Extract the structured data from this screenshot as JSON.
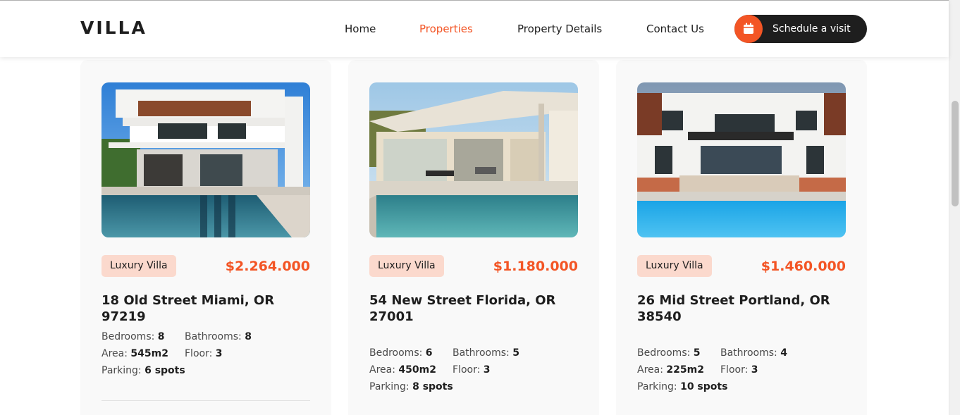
{
  "brand": {
    "logo": "VILLA"
  },
  "nav": {
    "items": [
      {
        "label": "Home",
        "active": false
      },
      {
        "label": "Properties",
        "active": true
      },
      {
        "label": "Property Details",
        "active": false
      },
      {
        "label": "Contact Us",
        "active": false
      }
    ],
    "cta": {
      "label": "Schedule a visit",
      "icon": "calendar-icon"
    }
  },
  "colors": {
    "accent": "#f35525",
    "dark": "#1e1e1e",
    "badge_bg": "#fbd9cd",
    "card_bg": "#f9f9f9"
  },
  "listings": [
    {
      "category": "Luxury Villa",
      "price": "$2.264.000",
      "address": "18 Old Street Miami, OR 97219",
      "bedrooms_label": "Bedrooms:",
      "bedrooms": "8",
      "bathrooms_label": "Bathrooms:",
      "bathrooms": "8",
      "area_label": "Area:",
      "area": "545m2",
      "floor_label": "Floor:",
      "floor": "3",
      "parking_label": "Parking:",
      "parking": "6 spots"
    },
    {
      "category": "Luxury Villa",
      "price": "$1.180.000",
      "address": "54 New Street Florida, OR 27001",
      "bedrooms_label": "Bedrooms:",
      "bedrooms": "6",
      "bathrooms_label": "Bathrooms:",
      "bathrooms": "5",
      "area_label": "Area:",
      "area": "450m2",
      "floor_label": "Floor:",
      "floor": "3",
      "parking_label": "Parking:",
      "parking": "8 spots"
    },
    {
      "category": "Luxury Villa",
      "price": "$1.460.000",
      "address": "26 Mid Street Portland, OR 38540",
      "bedrooms_label": "Bedrooms:",
      "bedrooms": "5",
      "bathrooms_label": "Bathrooms:",
      "bathrooms": "4",
      "area_label": "Area:",
      "area": "225m2",
      "floor_label": "Floor:",
      "floor": "3",
      "parking_label": "Parking:",
      "parking": "10 spots"
    }
  ]
}
